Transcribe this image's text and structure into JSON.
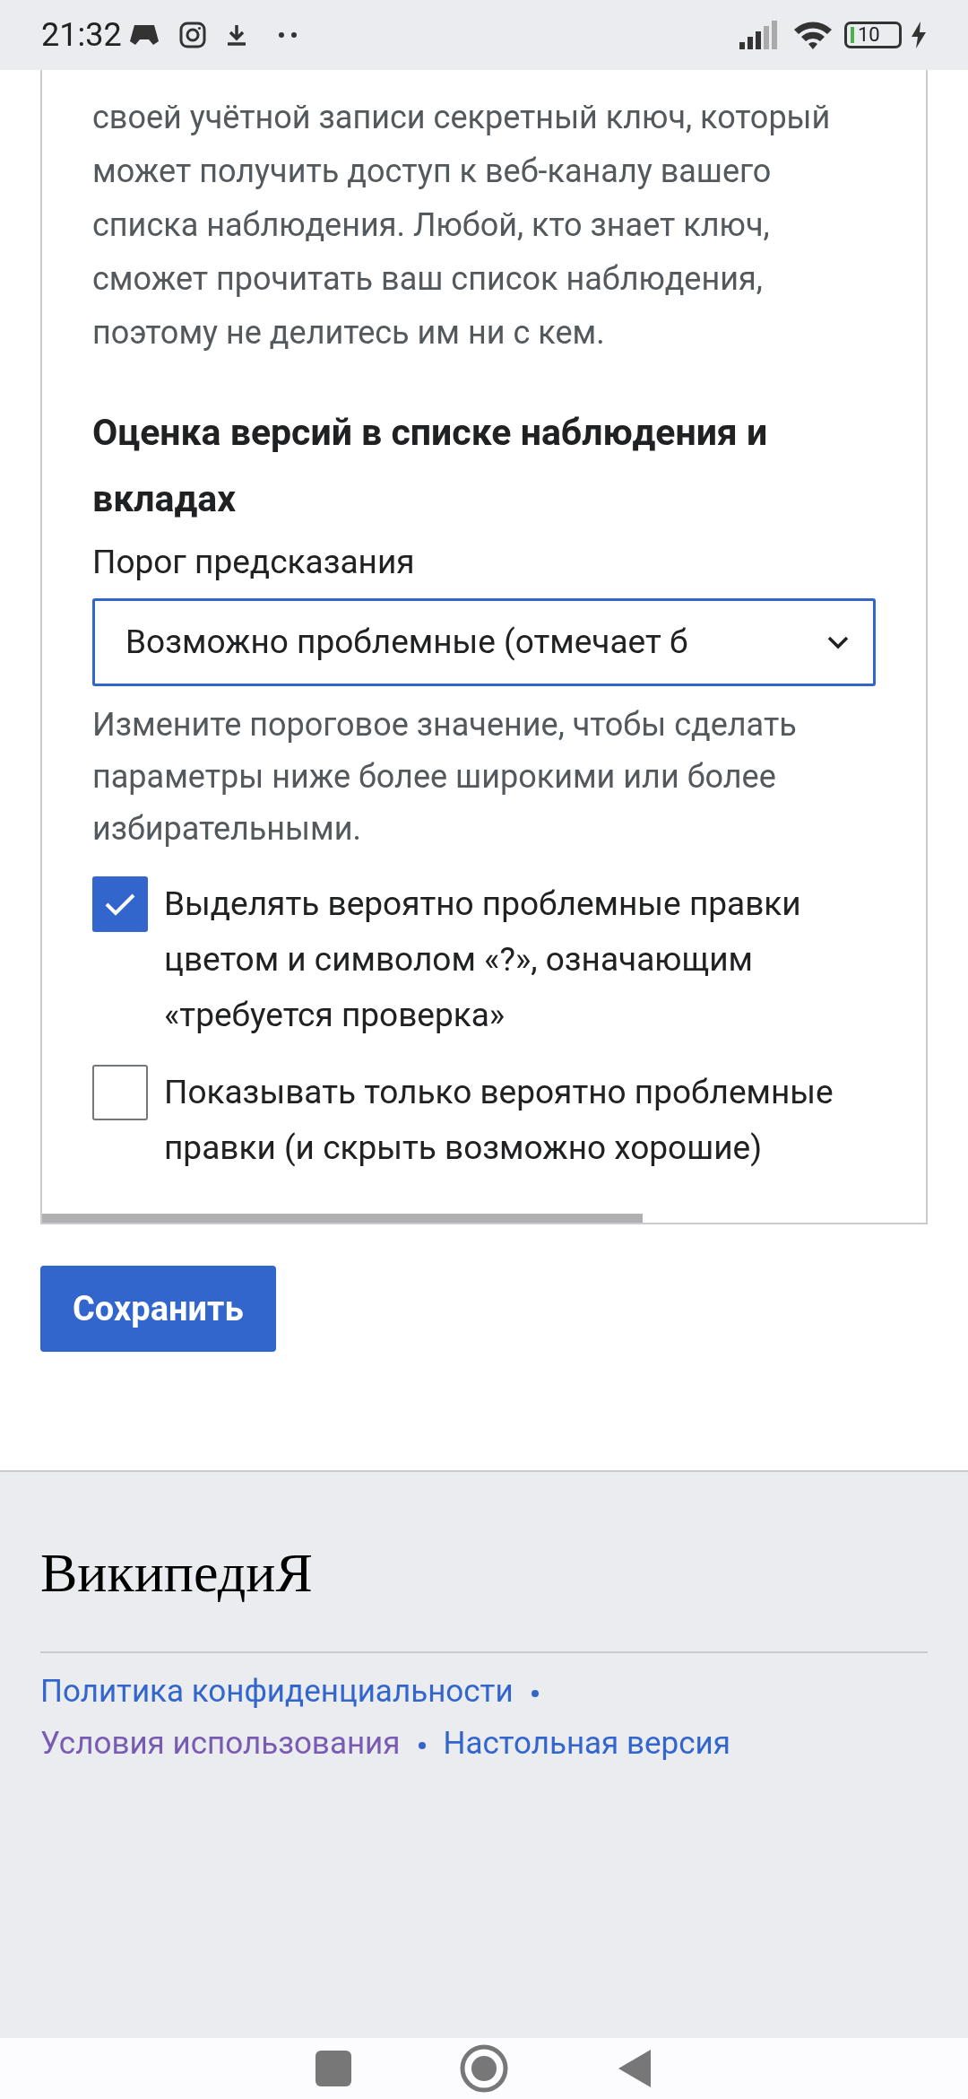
{
  "status_bar": {
    "time": "21:32",
    "battery": "10"
  },
  "panel": {
    "paragraph": "своей учётной записи секретный ключ, который может получить доступ к веб-каналу вашего списка наблюдения. Любой, кто знает ключ, сможет прочитать ваш список наблюдения, поэтому не делитесь им ни с кем.",
    "heading": "Оценка версий в списке наблюдения и вкладах",
    "select": {
      "label": "Порог предсказания",
      "value": "Возможно проблемные (отмечает б",
      "focused": true
    },
    "help": "Измените пороговое значение, чтобы сделать параметры ниже более широкими или более избирательными.",
    "checkboxes": [
      {
        "label": "Выделять вероятно проблемные правки цветом и символом «?», означающим «требуется проверка»",
        "checked": true
      },
      {
        "label": "Показывать только вероятно проблемные правки (и скрыть возможно хорошие)",
        "checked": false
      }
    ]
  },
  "save_button": "Сохранить",
  "footer": {
    "logo": "ВикипедиЯ",
    "links": [
      {
        "label": "Политика конфиденциальности",
        "visited": false
      },
      {
        "label": "Условия использования",
        "visited": true
      },
      {
        "label": "Настольная версия",
        "visited": false
      }
    ]
  }
}
